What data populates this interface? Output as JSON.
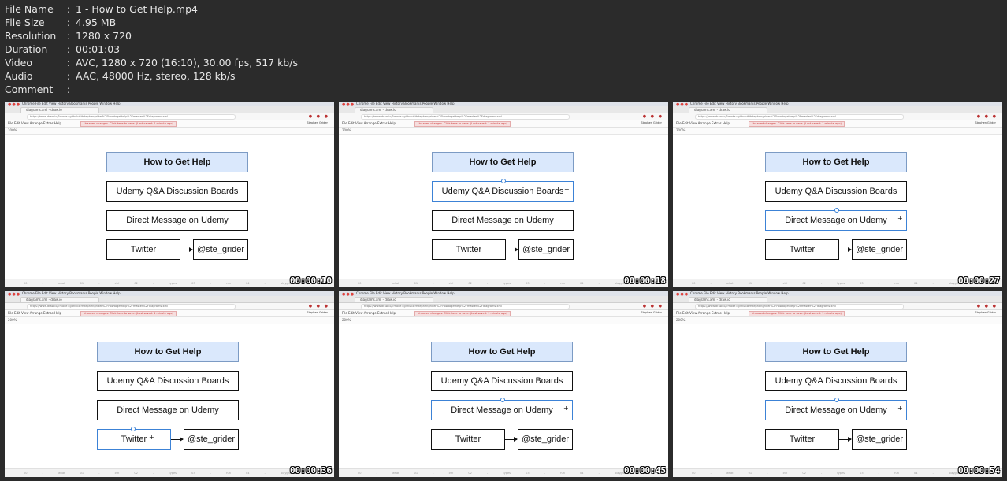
{
  "meta": [
    {
      "key": "File Name",
      "sep": ":",
      "value": "1 - How to Get Help.mp4"
    },
    {
      "key": "File Size",
      "sep": ":",
      "value": "4.95 MB"
    },
    {
      "key": "Resolution",
      "sep": ":",
      "value": "1280 x 720"
    },
    {
      "key": "Duration",
      "sep": ":",
      "value": "00:01:03"
    },
    {
      "key": "Video",
      "sep": ":",
      "value": "AVC, 1280 x 720 (16:10), 30.00 fps, 517 kb/s"
    },
    {
      "key": "Audio",
      "sep": ":",
      "value": "AAC, 48000 Hz, stereo, 128 kb/s"
    },
    {
      "key": "Comment",
      "sep": ":",
      "value": ""
    }
  ],
  "diagram": {
    "title": "How to Get Help",
    "box1": "Udemy Q&A Discussion Boards",
    "box2": "Direct Message on Udemy",
    "box3": "Twitter",
    "box4": "@ste_grider"
  },
  "ui": {
    "tab_title": "diagrams.xml - draw.io",
    "url": "https://www.draw.io/?mode=github#Hstephengrider%2Fhowtogethelp%2Fmaster%2Fdiagrams.xml",
    "menu": "File  Edit  View  Arrange  Extras  Help",
    "chrome_menu": "Chrome  File  Edit  View  History  Bookmarks  People  Window  Help",
    "warning": "Unsaved changes. Click here to save. (Last saved: 1 minute ago)",
    "user": "Stephen Grider",
    "zoom": "200%",
    "pages": "00 - what  01 - ctrl  02 - types  03 - run  04 - playground  05 - summary  06 - rbc  07 - mode  08 - options"
  },
  "thumbnails": [
    {
      "timestamp": "00:00:10",
      "selected": "none"
    },
    {
      "timestamp": "00:00:18",
      "selected": "box1"
    },
    {
      "timestamp": "00:00:27",
      "selected": "box2"
    },
    {
      "timestamp": "00:00:36",
      "selected": "box3"
    },
    {
      "timestamp": "00:00:45",
      "selected": "box2"
    },
    {
      "timestamp": "00:00:54",
      "selected": "box2"
    }
  ]
}
